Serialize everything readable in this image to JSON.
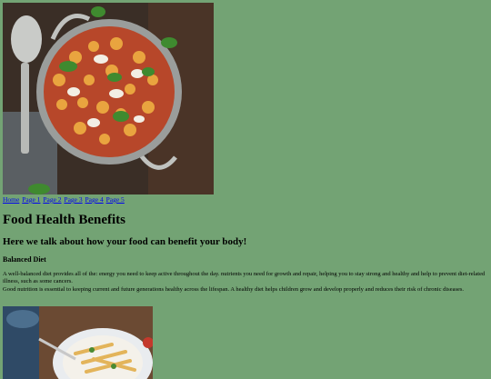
{
  "hero_image": {
    "alt": "Baked gnocchi with tomato sauce, mozzarella and basil in a metal pan"
  },
  "nav": {
    "links": [
      "Home",
      "Page 1",
      "Page 2",
      "Page 3",
      "Page 4",
      "Page 5"
    ]
  },
  "main": {
    "title": "Food Health Benefits",
    "subtitle": "Here we talk about how your food can benefit your body!",
    "section_heading": "Balanced Diet",
    "paragraph_1": "A well-balanced diet provides all of the: energy you need to keep active throughout the day. nutrients you need for growth and repair, helping you to stay strong and healthy and help to prevent diet-related illness, such as some cancers.",
    "paragraph_2": "Good nutrition is essential to keeping current and future generations healthy across the lifespan. A healthy diet helps children grow and develop properly and reduces their risk of chronic diseases."
  },
  "second_image": {
    "alt": "Plate of pasta with vegetables on a wooden table"
  },
  "colors": {
    "background": "#73a374",
    "link": "#0000ee"
  }
}
